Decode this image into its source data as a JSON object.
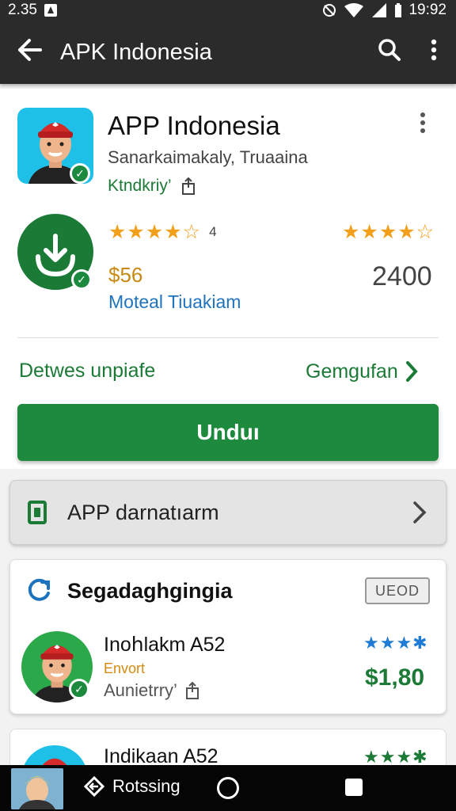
{
  "status_bar": {
    "time_left": "2.35",
    "time_right": "19:92"
  },
  "app_bar": {
    "title": "APK Indonesia",
    "icons": [
      "back-arrow-icon",
      "search-icon",
      "more-vert-icon"
    ]
  },
  "app": {
    "name": "APP Indonesia",
    "developer": "Sanarkaimakaly, Truaaina",
    "category": "Ktndkriy’",
    "rating_value": "4",
    "price": "$56",
    "count": "2400",
    "subtitle": "Moteal Tiuakiam",
    "link_left": "Detwes unpiafe",
    "link_right": "Gemgufan",
    "install_label": "Unduı"
  },
  "permissions": {
    "label": "APP darnatıarm"
  },
  "related": {
    "title": "Segadaghgingia",
    "badge": "UEOD",
    "item": {
      "name": "Inoհlakm A52",
      "tag": "Envort",
      "developer": "Aunietrry’",
      "price": "$1,80"
    },
    "item2": {
      "name": "Indikaan A52"
    }
  },
  "nav_bar": {
    "back_label": "Rotssing"
  },
  "colors": {
    "primary_green": "#1d8a3d",
    "rating_gold": "#f2a01b",
    "link_blue": "#1e73be",
    "app_bar": "#2b2b2b"
  }
}
